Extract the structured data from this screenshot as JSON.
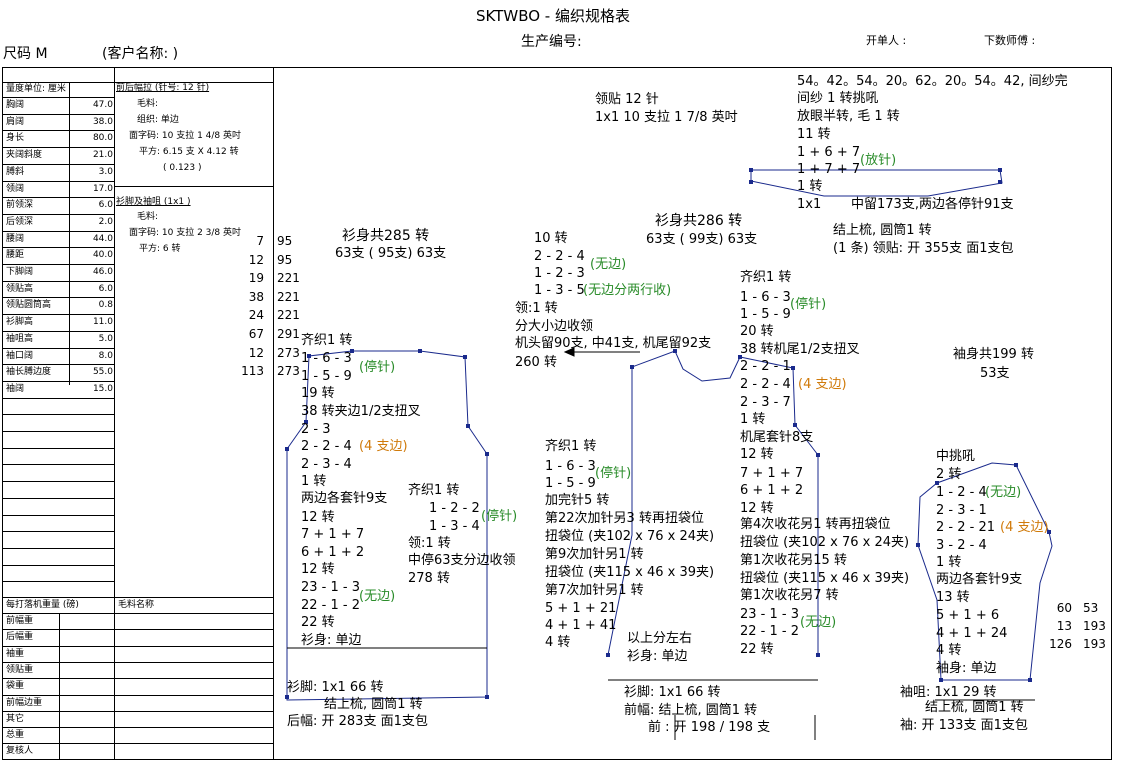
{
  "header": {
    "title": "SKTWBO - 编织规格表",
    "production_no": "生产编号:",
    "opener": "开单人 :",
    "knit_master": "下数师傅 :",
    "size": "尺码  M",
    "client": "(客户名称: )"
  },
  "measure_table": {
    "unit_label": "量度单位: 厘米",
    "rows": [
      {
        "name": "胸阔",
        "value": "47.0"
      },
      {
        "name": "肩阔",
        "value": "38.0"
      },
      {
        "name": "身长",
        "value": "80.0"
      },
      {
        "name": "夹阔斜度",
        "value": "21.0"
      },
      {
        "name": "膊斜",
        "value": "3.0"
      },
      {
        "name": "领阔",
        "value": "17.0"
      },
      {
        "name": "前领深",
        "value": "6.0"
      },
      {
        "name": "后领深",
        "value": "2.0"
      },
      {
        "name": "腰阔",
        "value": "44.0"
      },
      {
        "name": "腰距",
        "value": "40.0"
      },
      {
        "name": "下脚阔",
        "value": "46.0"
      },
      {
        "name": "领贴高",
        "value": "6.0"
      },
      {
        "name": "领贴圆筒高",
        "value": "0.8"
      },
      {
        "name": "衫脚高",
        "value": "11.0"
      },
      {
        "name": "袖咀高",
        "value": "5.0"
      },
      {
        "name": "袖口阔",
        "value": "8.0"
      },
      {
        "name": "袖长膊边度",
        "value": "55.0"
      },
      {
        "name": "袖阔",
        "value": "15.0"
      }
    ]
  },
  "spec_block_1": {
    "title": "前后幅拉 (针号: 12 针)",
    "yarn": "毛料:",
    "stitch": "组织: 单边",
    "gauge": "面字码: 10 支拉 1 4/8 英吋",
    "square": "平方: 6.15 支 X  4.12 转",
    "ratio": "( 0.123 )"
  },
  "spec_block_2": {
    "title": "衫脚及袖咀 (1x1 )",
    "yarn": "毛料:",
    "gauge": "面字码: 10 支拉 2 3/8 英吋",
    "square": "平方: 6 转"
  },
  "weight_table": {
    "title": "每打落机重量 (磅)",
    "yarn_name": "毛料名称",
    "rows": [
      "前幅重",
      "后幅重",
      "袖重",
      "领贴重",
      "袋重",
      "前幅边重",
      "其它",
      "总重",
      "复核人"
    ]
  },
  "side_numbers": [
    {
      "a": "7",
      "b": "95"
    },
    {
      "a": "12",
      "b": "95"
    },
    {
      "a": "19",
      "b": "221"
    },
    {
      "a": "38",
      "b": "221"
    },
    {
      "a": "24",
      "b": "221"
    },
    {
      "a": "67",
      "b": "291"
    },
    {
      "a": "12",
      "b": "273"
    },
    {
      "a": "113",
      "b": "273"
    }
  ],
  "back": {
    "total": "衫身共285 转",
    "needles": "63支 ( 95支) 63支",
    "neck": [
      "齐织1 转",
      "1 - 6 - 3",
      "1 - 5 - 9"
    ],
    "neck_note": "(停针)",
    "rows1": [
      "19 转",
      "38 转夹边1/2支扭叉"
    ],
    "arm": [
      "2 - 3",
      "2 - 2 - 4",
      "2 - 3 - 4"
    ],
    "arm_note": "(4 支边)",
    "rows2": [
      "1 转",
      "两边各套针9支",
      "12 转",
      "7 + 1 + 7",
      "6 + 1 + 2",
      "12 转",
      "23 - 1 - 3",
      "22 - 1 - 2"
    ],
    "bot_note": "(无边)",
    "rows3": [
      "22 转",
      "衫身: 单边"
    ],
    "hem": "衫脚: 1x1     66 转",
    "cast": "结上梳, 圆筒1 转",
    "open": "后幅: 开 283支 面1支包"
  },
  "back_neck": {
    "flat": "齐织1 转",
    "r1": "1 - 2 - 2",
    "r2": "1 - 3 - 4",
    "note": "(停针)",
    "collar": "领:1 转",
    "mid": "中停63支分边收领",
    "rows": "278 转"
  },
  "front_neck": {
    "rows": [
      "10 转",
      "2 - 2 - 4",
      "1 - 2 - 3",
      "1 - 3 - 5"
    ],
    "note1": "(无边)",
    "note2": "(无边分两行收)",
    "collar": "领:1 转",
    "split": "分大小边收领",
    "machine": "机头留90支, 中41支, 机尾留92支",
    "total": "260 转"
  },
  "front": {
    "total": "衫身共286 转",
    "needles": "63支 ( 99支) 63支",
    "left": [
      "齐织1 转",
      "1 - 6 - 3",
      "1 - 5 - 9",
      "加完针5 转",
      "第22次加针另3 转再扭袋位",
      "扭袋位 (夹102 x 76 x 24夹)",
      "第9次加针另1 转",
      "扭袋位 (夹115 x 46 x 39夹)",
      "第7次加针另1 转",
      "5 + 1 + 21",
      "4 + 1 + 41",
      "4 转"
    ],
    "left_note": "(停针)",
    "right": [
      "齐织1 转",
      "1 - 6 - 3",
      "1 - 5 - 9",
      "20 转",
      "38 转机尾1/2支扭叉",
      "2 - 2 - 1",
      "2 - 2 - 4",
      "2 - 3 - 7",
      "1 转",
      "机尾套针8支",
      "12 转",
      "7 + 1 + 7",
      "6 + 1 + 2",
      "12 转",
      "第4次收花另1 转再扭袋位",
      "扭袋位 (夹102 x 76 x 24夹)",
      "第1次收花另15 转",
      "扭袋位 (夹115 x 46 x 39夹)",
      "第1次收花另7 转",
      "23 - 1 - 3",
      "22 - 1 - 2",
      "22 转"
    ],
    "right_note1": "(停针)",
    "right_note2": "(4 支边)",
    "right_note3": "(无边)",
    "split": "以上分左右",
    "body": "衫身: 单边",
    "hem": "衫脚: 1x1     66 转",
    "cast": "前幅: 结上梳, 圆筒1 转",
    "open": "前 :  开 198 / 198 支"
  },
  "collar_band": {
    "title": "领贴  12 针",
    "gauge": "1x1    10 支拉 1 7/8 英吋",
    "seq": "54。42。54。20。62。20。54。42, 间纱完",
    "lines": [
      "间纱 1 转挑吼",
      "放眼半转, 毛 1 转",
      "11 转",
      "1 + 6 + 7",
      "1 + 7 + 7",
      "1 转",
      "1x1"
    ],
    "note": "(放针)",
    "stop": "中留173支,两边各停针91支",
    "cast": "结上梳, 圆筒1 转",
    "open": "(1 条) 领贴: 开 355支 面1支包"
  },
  "sleeve": {
    "total": "袖身共199 转",
    "needles": "53支",
    "top": [
      "中挑吼",
      "2 转",
      "1 - 2 - 4",
      "2 - 3 - 1",
      "2 - 2 - 21",
      "3 - 2 - 4",
      "1 转",
      "两边各套针9支",
      "13 转",
      "5 + 1 + 6",
      "4 + 1 + 24",
      "4 转",
      "袖身: 单边"
    ],
    "note1": "(无边)",
    "note2": "(4 支边)",
    "cuff": "袖咀: 1x1    29 转",
    "cast": "结上梳, 圆筒1 转",
    "open": "袖: 开 133支 面1支包",
    "nums": [
      {
        "a": "60",
        "b": "53"
      },
      {
        "a": "13",
        "b": "193"
      },
      {
        "a": "126",
        "b": "193"
      }
    ]
  }
}
